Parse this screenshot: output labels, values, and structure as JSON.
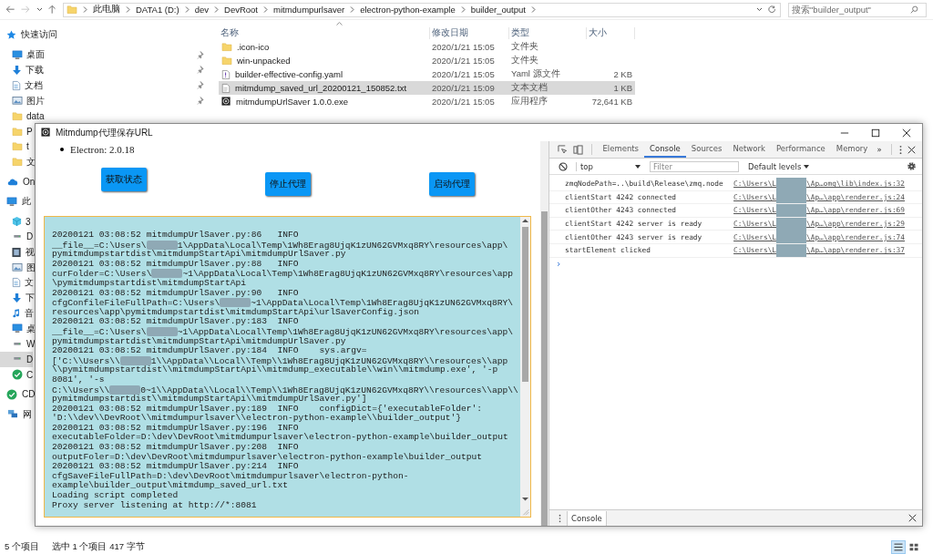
{
  "explorer": {
    "crumbs": [
      "此电脑",
      "DATA1 (D:)",
      "dev",
      "DevRoot",
      "mitmdumpurlsaver",
      "electron-python-example",
      "builder_output"
    ],
    "search": {
      "placeholder": "搜索\"builder_output\""
    },
    "sidebar": [
      {
        "label": "快速访问",
        "kind": "star",
        "selected": false,
        "children": [
          {
            "label": "桌面",
            "kind": "desktop",
            "pinned": true,
            "selected": false
          },
          {
            "label": "下载",
            "kind": "download",
            "pinned": true,
            "selected": false
          },
          {
            "label": "文档",
            "kind": "document",
            "pinned": true,
            "selected": false
          },
          {
            "label": "图片",
            "kind": "picture",
            "pinned": true,
            "selected": false
          },
          {
            "label": "data",
            "kind": "folder",
            "pinned": false,
            "selected": false
          },
          {
            "label": "P",
            "kind": "folder",
            "pinned": false,
            "selected": false
          },
          {
            "label": "t",
            "kind": "folder",
            "pinned": false,
            "selected": false
          },
          {
            "label": "文",
            "kind": "folder",
            "pinned": false,
            "selected": false
          }
        ]
      },
      {
        "label": "On",
        "kind": "cloud",
        "selected": false
      },
      {
        "label": "此",
        "kind": "desktop",
        "selected": false,
        "children": [
          {
            "label": "3",
            "kind": "cube",
            "selected": false
          },
          {
            "label": "D",
            "kind": "drive",
            "selected": false
          },
          {
            "label": "视",
            "kind": "video",
            "selected": false
          },
          {
            "label": "图",
            "kind": "picture",
            "selected": false
          },
          {
            "label": "文",
            "kind": "document",
            "selected": false
          },
          {
            "label": "下",
            "kind": "download",
            "selected": false
          },
          {
            "label": "音",
            "kind": "music",
            "selected": false
          },
          {
            "label": "桌",
            "kind": "desktop",
            "selected": false
          },
          {
            "label": "W",
            "kind": "drive",
            "selected": false
          },
          {
            "label": "D",
            "kind": "drive",
            "selected": true
          },
          {
            "label": "C",
            "kind": "cd",
            "selected": false
          }
        ]
      },
      {
        "label": "CD",
        "kind": "cd",
        "selected": false
      },
      {
        "label": "网",
        "kind": "network",
        "selected": false
      }
    ],
    "columns": [
      "名称",
      "修改日期",
      "类型",
      "大小"
    ],
    "files": [
      {
        "name": ".icon-ico",
        "kind": "folder",
        "modified": "2020/1/21 15:05",
        "type": "文件夹",
        "selected": false
      },
      {
        "name": "win-unpacked",
        "kind": "folder",
        "modified": "2020/1/21 15:05",
        "type": "文件夹",
        "selected": false
      },
      {
        "name": "builder-effective-config.yaml",
        "kind": "yaml",
        "modified": "2020/1/21 15:05",
        "type": "Yaml 源文件",
        "size": "2 KB",
        "selected": false
      },
      {
        "name": "mitmdump_saved_url_20200121_150852.txt",
        "kind": "txt",
        "modified": "2020/1/21 15:09",
        "type": "文本文档",
        "size": "1 KB",
        "selected": true
      },
      {
        "name": "mitmdumpUrlSaver 1.0.0.exe",
        "kind": "exe",
        "modified": "2020/1/21 15:05",
        "type": "应用程序",
        "size": "72,641 KB",
        "selected": false
      }
    ],
    "status": {
      "count": "5 个项目",
      "selection": "选中 1 个项目  417 字节"
    },
    "views": [
      {
        "kind": "details",
        "selected": true
      },
      {
        "kind": "tiles",
        "selected": false
      }
    ]
  },
  "app": {
    "title": "Mitmdump代理保存URL",
    "versions": [
      "Electron: 2.0.18"
    ],
    "buttons": [
      "获取状态",
      "停止代理",
      "启动代理"
    ],
    "log": [
      {
        "segments": [
          "20200121 03:08:52 mitmdumpUrlSaver.py:86   INFO"
        ]
      },
      {
        "segments": [
          "__file__=C:\\Users\\",
          "1\\AppData\\Local\\Temp\\1Wh8Erag8UjqK1zUN62GVMxq8RY\\resources\\app\\"
        ]
      },
      {
        "segments": [
          "pymitmdumpstartdist\\mitmdumpStartApi\\mitmdumpUrlSaver.py"
        ]
      },
      {
        "segments": [
          "20200121 03:08:52 mitmdumpUrlSaver.py:88   INFO"
        ]
      },
      {
        "segments": [
          "curFolder=C:\\Users\\",
          "~1\\AppData\\Local\\Temp\\1Wh8Erag8UjqK1zUN62GVMxq8RY\\resources\\app"
        ]
      },
      {
        "segments": [
          "\\pymitmdumpstartdist\\mitmdumpStartApi"
        ]
      },
      {
        "segments": [
          "20200121 03:08:52 mitmdumpUrlSaver.py:90   INFO"
        ]
      },
      {
        "segments": [
          "cfgConfileFileFullPath=C:\\Users\\",
          "~1\\AppData\\Local\\Temp\\1Wh8Erag8UjqK1zUN62GVMxq8RY\\"
        ]
      },
      {
        "segments": [
          "resources\\app\\pymitmdumpstartdist\\mitmdumpStartApi\\urlSaverConfig.json"
        ]
      },
      {
        "segments": [
          "20200121 03:08:52 mitmdumpUrlSaver.py:183  INFO"
        ]
      },
      {
        "segments": [
          "__file__=C:\\Users\\",
          "~1\\AppData\\Local\\Temp\\1Wh8Erag8UjqK1zUN62GVMxq8RY\\resources\\app\\"
        ]
      },
      {
        "segments": [
          "pymitmdumpstartdist\\mitmdumpStartApi\\mitmdumpUrlSaver.py"
        ]
      },
      {
        "segments": [
          "20200121 03:08:52 mitmdumpUrlSaver.py:184  INFO    sys.argv="
        ]
      },
      {
        "segments": [
          "['C:\\\\Users\\\\",
          "1\\\\AppData\\\\Local\\\\Temp\\\\1Wh8Erag8UjqK1zUN62GVMxq8RY\\\\resources\\\\app"
        ]
      },
      {
        "segments": [
          "\\\\pymitmdumpstartdist\\\\mitmdumpStartApi\\\\mitmdump_executable\\\\win\\\\mitmdump.exe', '-p"
        ]
      },
      {
        "segments": [
          "8081', '-s"
        ]
      },
      {
        "segments": [
          "C:\\\\Users\\\\",
          "0~1\\\\AppData\\\\Local\\\\Temp\\\\1Wh8Erag8UjqK1zUN62GVMxq8RY\\\\resources\\\\app\\\\"
        ]
      },
      {
        "segments": [
          "pymitmdumpstartdist\\\\mitmdumpStartApi\\\\mitmdumpUrlSaver.py']"
        ]
      },
      {
        "segments": [
          "20200121 03:08:52 mitmdumpUrlSaver.py:189  INFO    configDict={'executableFolder':"
        ]
      },
      {
        "segments": [
          "'D:\\\\dev\\\\DevRoot\\\\mitmdumpurlsaver\\\\electron-python-example\\\\builder_output'}"
        ]
      },
      {
        "segments": [
          "20200121 03:08:52 mitmdumpUrlSaver.py:196  INFO"
        ]
      },
      {
        "segments": [
          "executableFolder=D:\\dev\\DevRoot\\mitmdumpurlsaver\\electron-python-example\\builder_output"
        ]
      },
      {
        "segments": [
          "20200121 03:08:52 mitmdumpUrlSaver.py:208  INFO"
        ]
      },
      {
        "segments": [
          "outputFoler=D:\\dev\\DevRoot\\mitmdumpurlsaver\\electron-python-example\\builder_output"
        ]
      },
      {
        "segments": [
          "20200121 03:08:52 mitmdumpUrlSaver.py:214  INFO"
        ]
      },
      {
        "segments": [
          "cfgSaveFileFullPath=D:\\dev\\DevRoot\\mitmdumpurlsaver\\electron-python-"
        ]
      },
      {
        "segments": [
          "example\\builder_output\\mitmdump_saved_url.txt"
        ]
      },
      {
        "segments": [
          "Loading script completed"
        ]
      },
      {
        "segments": [
          "Proxy server listening at http://*:8081"
        ]
      }
    ],
    "devtools": {
      "tabs": [
        {
          "label": "Elements",
          "selected": false
        },
        {
          "label": "Console",
          "selected": true
        },
        {
          "label": "Sources",
          "selected": false
        },
        {
          "label": "Network",
          "selected": false
        },
        {
          "label": "Performance",
          "selected": false
        },
        {
          "label": "Memory",
          "selected": false
        }
      ],
      "more": "»",
      "context": "top",
      "filter": {
        "placeholder": "Filter"
      },
      "levels": "Default levels",
      "messages": [
        {
          "text": "zmqNodePath=..\\build\\Release\\zmq.node",
          "source": [
            "C:\\Users\\L",
            "\\Ap…omg\\lib\\index.js:32"
          ]
        },
        {
          "text": "clientStart 4242 connected",
          "source": [
            "C:\\Users\\L",
            "\\Ap…\\app\\renderer.js:24"
          ]
        },
        {
          "text": "clientOther 4243 connected",
          "source": [
            "C:\\Users\\L",
            "\\Ap…\\app\\renderer.js:69"
          ]
        },
        {
          "text": "clientStart 4242 server is ready",
          "source": [
            "C:\\Users\\L",
            "\\Ap…\\app\\renderer.js:29"
          ]
        },
        {
          "text": "clientOther 4243 server is ready",
          "source": [
            "C:\\Users\\L",
            "\\Ap…\\app\\renderer.js:74"
          ]
        },
        {
          "text": "startElement clicked",
          "source": [
            "C:\\Users\\L",
            "\\Ap…\\app\\renderer.js:37"
          ]
        }
      ],
      "prompt": "›",
      "drawer_tab": "Console"
    }
  }
}
